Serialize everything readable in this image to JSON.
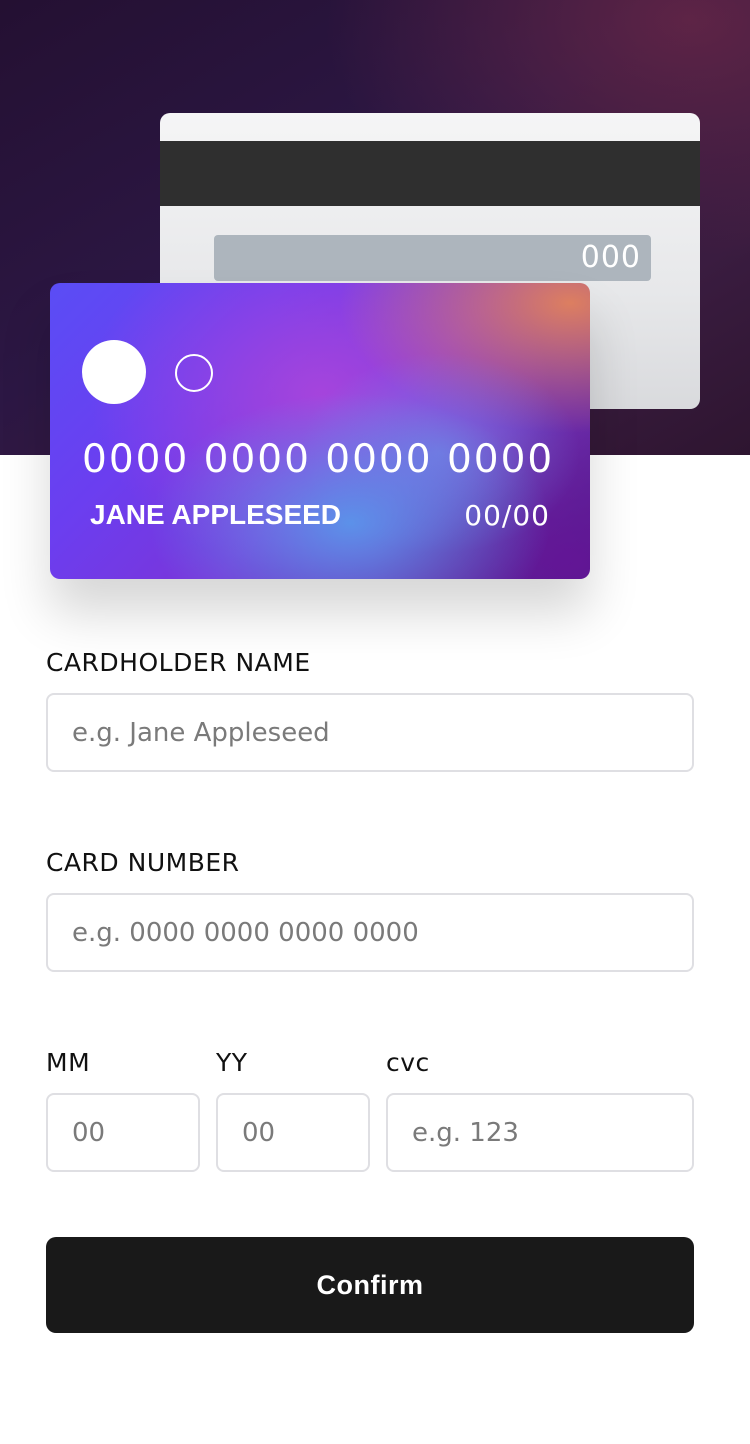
{
  "card_back": {
    "cvc": "000"
  },
  "card_front": {
    "number": "0000 0000 0000 0000",
    "name": "JANE APPLESEED",
    "expiry": "00/00"
  },
  "form": {
    "name_label": "CARDHOLDER NAME",
    "name_placeholder": "e.g. Jane Appleseed",
    "number_label": "CARD NUMBER",
    "number_placeholder": "e.g. 0000 0000 0000 0000",
    "mm_label": "MM",
    "mm_placeholder": "00",
    "yy_label": "YY",
    "yy_placeholder": "00",
    "cvc_label": "cvc",
    "cvc_placeholder": "e.g. 123",
    "confirm_label": "Confirm"
  },
  "colors": {
    "hero_background": "#2a1540",
    "button_background": "#191919",
    "field_border": "#dfdfe3"
  }
}
